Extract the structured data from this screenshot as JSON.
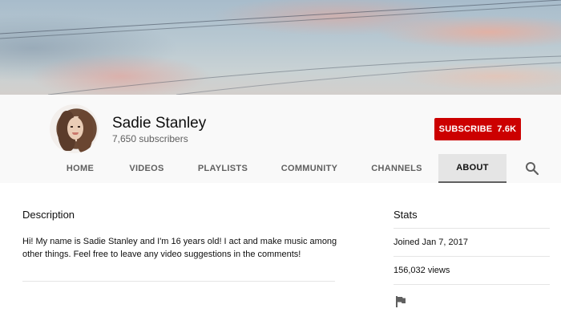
{
  "channel": {
    "name": "Sadie Stanley",
    "subscribers": "7,650 subscribers"
  },
  "subscribe": {
    "label": "SUBSCRIBE",
    "count": "7.6K"
  },
  "tabs": [
    {
      "label": "HOME"
    },
    {
      "label": "VIDEOS"
    },
    {
      "label": "PLAYLISTS"
    },
    {
      "label": "COMMUNITY"
    },
    {
      "label": "CHANNELS"
    },
    {
      "label": "ABOUT"
    }
  ],
  "active_tab": "ABOUT",
  "about": {
    "description_heading": "Description",
    "description": "Hi! My name is Sadie Stanley and I'm 16 years old! I act and make music among other things. Feel free to leave any video suggestions in the comments!",
    "stats_heading": "Stats",
    "joined": "Joined Jan 7, 2017",
    "views": "156,032 views"
  },
  "icons": {
    "search": "search-icon",
    "report": "flag-icon"
  },
  "colors": {
    "subscribe_bg": "#cc0000",
    "header_bg": "#f9f9f9",
    "active_tab_bg": "#e5e5e5"
  }
}
